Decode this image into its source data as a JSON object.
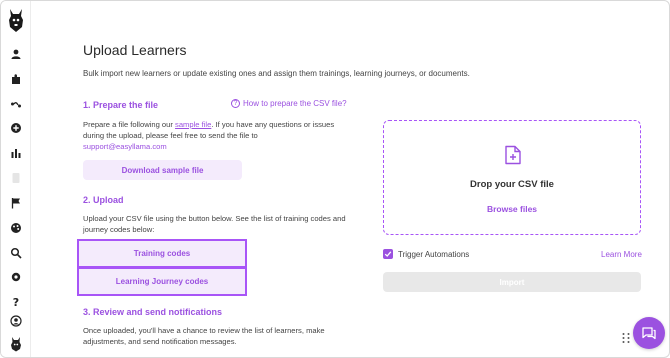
{
  "page": {
    "title": "Upload Learners",
    "description": "Bulk import new learners or update existing ones and assign them trainings, learning journeys, or documents."
  },
  "sidebar": {
    "logo_icon": "llama-logo-icon",
    "items": [
      {
        "icon": "user-icon"
      },
      {
        "icon": "puzzle-icon"
      },
      {
        "icon": "route-icon"
      },
      {
        "icon": "plus-circle-icon"
      },
      {
        "icon": "bar-chart-icon"
      },
      {
        "icon": "document-icon"
      },
      {
        "icon": "flag-icon"
      },
      {
        "icon": "palette-icon"
      },
      {
        "icon": "search-icon"
      },
      {
        "icon": "gear-icon"
      },
      {
        "icon": "help-icon"
      },
      {
        "icon": "account-icon"
      },
      {
        "icon": "llama-small-icon"
      }
    ]
  },
  "step1": {
    "title": "1. Prepare the file",
    "help_link": "How to prepare the CSV file?",
    "text_before": "Prepare a file following our ",
    "sample_link": "sample file",
    "text_after": ". If you have any questions or issues during the upload, please feel free to send the file to",
    "email": "support@easyllama.com",
    "download_button": "Download sample file"
  },
  "step2": {
    "title": "2. Upload",
    "text": "Upload your CSV file using the button below. See the list of training codes and journey codes below:",
    "training_codes_button": "Training codes",
    "journey_codes_button": "Learning Journey codes"
  },
  "step3": {
    "title": "3. Review and send notifications",
    "text": "Once uploaded, you'll have a chance to review the list of learners, make adjustments, and send notification messages."
  },
  "dropzone": {
    "title": "Drop your CSV file",
    "browse": "Browse files"
  },
  "options": {
    "trigger_automations_label": "Trigger Automations",
    "trigger_automations_checked": true,
    "learn_more": "Learn More"
  },
  "import_button": "Import",
  "colors": {
    "accent": "#9b51e0",
    "accent_light": "#f4ebfc",
    "disabled": "#e8e8e8"
  }
}
